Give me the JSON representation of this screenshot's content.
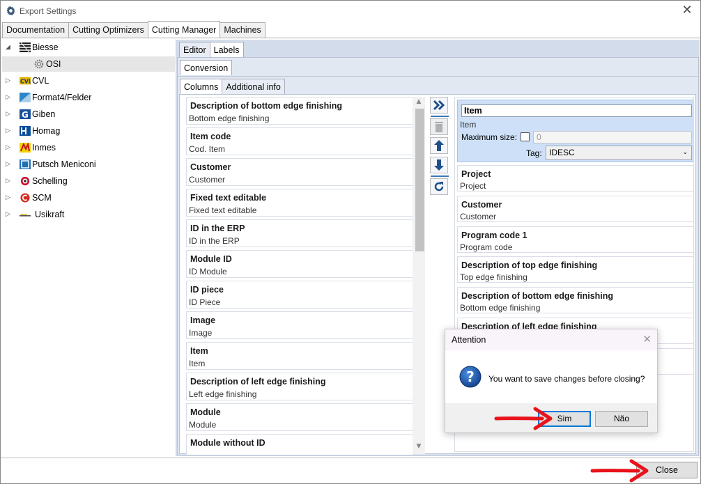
{
  "window": {
    "title": "Export Settings"
  },
  "main_tabs": [
    "Documentation",
    "Cutting Optimizers",
    "Cutting Manager",
    "Machines"
  ],
  "tree": {
    "items": [
      {
        "label": "Biesse",
        "expander": "◢",
        "icon": "biesse-logo-icon"
      },
      {
        "label": "OSI",
        "expander": "",
        "icon": "gear-icon"
      },
      {
        "label": "CVL",
        "expander": "▷",
        "icon": "cvl-logo-icon"
      },
      {
        "label": "Format4/Felder",
        "expander": "▷",
        "icon": "format4-logo-icon"
      },
      {
        "label": "Giben",
        "expander": "▷",
        "icon": "giben-logo-icon"
      },
      {
        "label": "Homag",
        "expander": "▷",
        "icon": "homag-logo-icon"
      },
      {
        "label": "Inmes",
        "expander": "▷",
        "icon": "inmes-logo-icon"
      },
      {
        "label": "Putsch Meniconi",
        "expander": "▷",
        "icon": "putsch-logo-icon"
      },
      {
        "label": "Schelling",
        "expander": "▷",
        "icon": "schelling-logo-icon"
      },
      {
        "label": "SCM",
        "expander": "▷",
        "icon": "scm-logo-icon"
      },
      {
        "label": "Usikraft",
        "expander": "▷",
        "icon": "usikraft-logo-icon"
      }
    ]
  },
  "sub_tabs": [
    "Editor",
    "Labels"
  ],
  "conversion_tab": "Conversion",
  "column_tabs": [
    "Columns",
    "Additional info"
  ],
  "available_columns": [
    {
      "title": "Description of bottom edge finishing",
      "sub": "Bottom edge finishing"
    },
    {
      "title": "Item code",
      "sub": "Cod. Item"
    },
    {
      "title": "Customer",
      "sub": "Customer"
    },
    {
      "title": "Fixed text editable",
      "sub": "Fixed text editable"
    },
    {
      "title": "ID in the ERP",
      "sub": "ID in the ERP"
    },
    {
      "title": "Module ID",
      "sub": "ID Module"
    },
    {
      "title": "ID piece",
      "sub": "ID Piece"
    },
    {
      "title": "Image",
      "sub": "Image"
    },
    {
      "title": "Item",
      "sub": "Item"
    },
    {
      "title": "Description of left edge finishing",
      "sub": "Left edge finishing"
    },
    {
      "title": "Module",
      "sub": "Module"
    },
    {
      "title": "Module without ID",
      "sub": ""
    }
  ],
  "selected_column": {
    "name": "Item",
    "sub": "Item",
    "max_size_label": "Maximum size:",
    "max_size_value": "0",
    "tag_label": "Tag:",
    "tag_value": "IDESC"
  },
  "chosen_columns": [
    {
      "title": "Project",
      "sub": "Project"
    },
    {
      "title": "Customer",
      "sub": "Customer"
    },
    {
      "title": "Program code 1",
      "sub": "Program code"
    },
    {
      "title": "Description of top edge finishing",
      "sub": "Top edge finishing"
    },
    {
      "title": "Description of bottom edge finishing",
      "sub": "Bottom edge finishing"
    },
    {
      "title": "Description of left edge finishing",
      "sub": ""
    }
  ],
  "footer": {
    "close_label": "Close"
  },
  "dialog": {
    "title": "Attention",
    "message": "You want to save changes before closing?",
    "yes_label": "Sim",
    "no_label": "Não"
  },
  "colors": {
    "accent": "#3a78b8",
    "selected_bg": "#cde0f7",
    "annotation_arrow": "#e8131b"
  }
}
